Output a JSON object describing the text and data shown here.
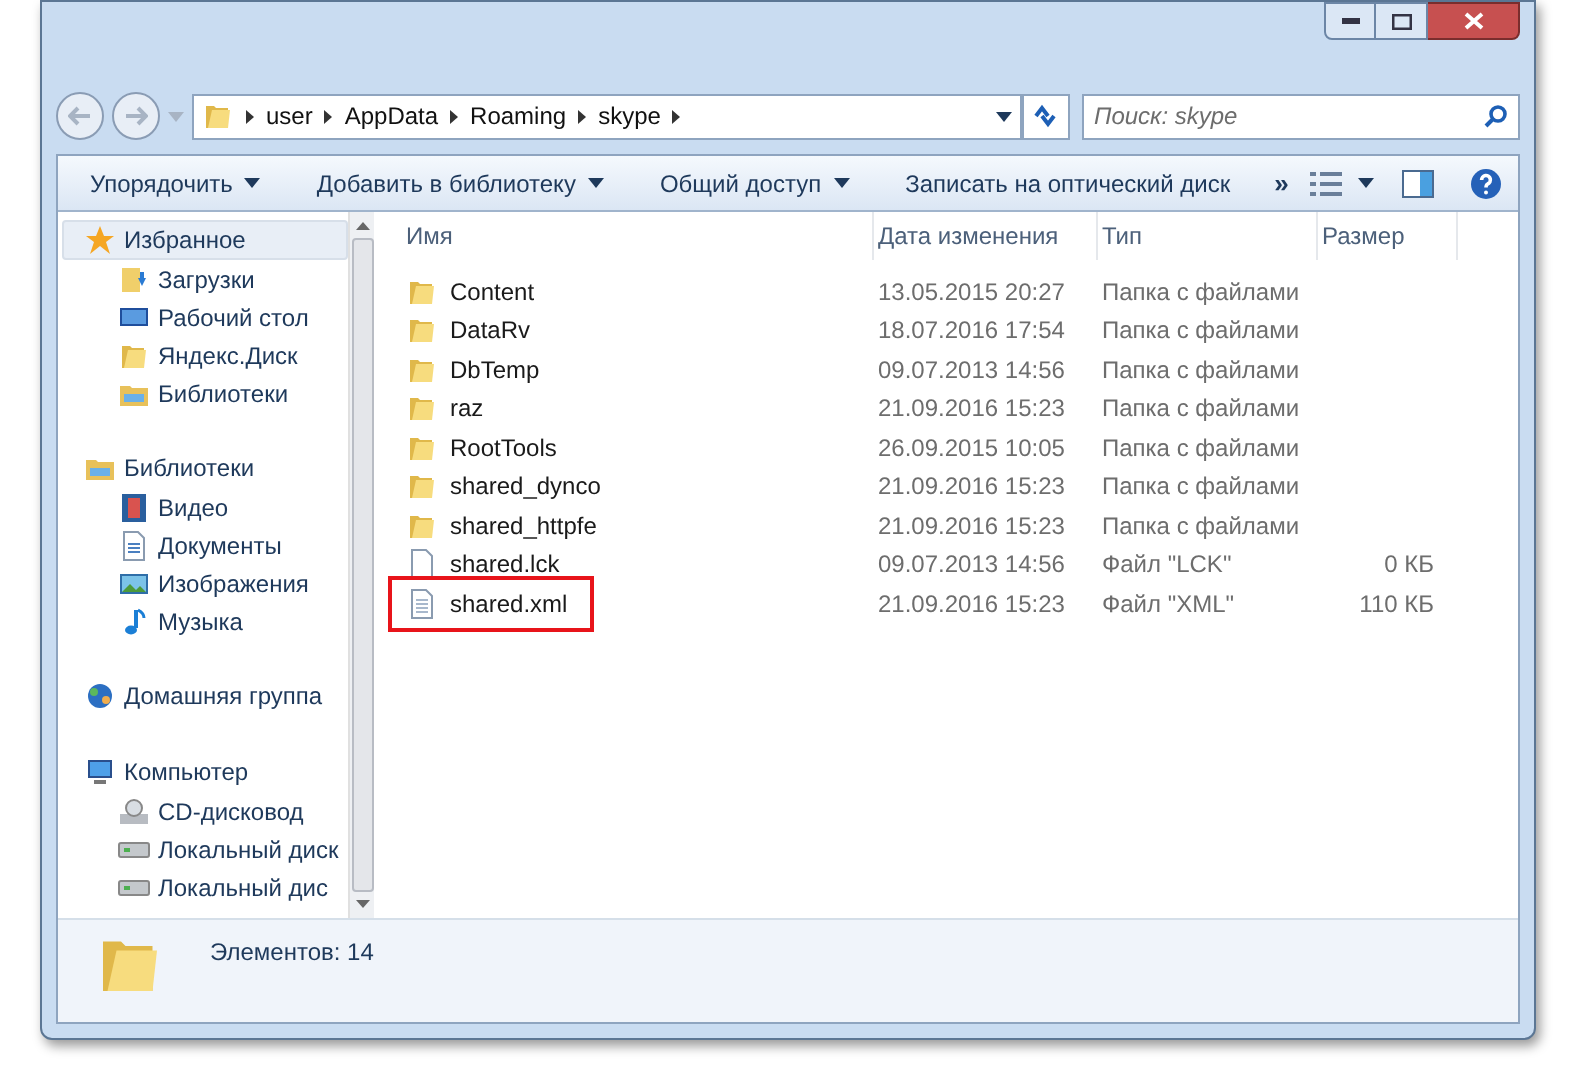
{
  "address": {
    "crumbs": [
      "user",
      "AppData",
      "Roaming",
      "skype"
    ]
  },
  "search": {
    "placeholder": "Поиск: skype"
  },
  "toolbar": {
    "items": [
      {
        "label": "Упорядочить",
        "dropdown": true
      },
      {
        "label": "Добавить в библиотеку",
        "dropdown": true
      },
      {
        "label": "Общий доступ",
        "dropdown": true
      },
      {
        "label": "Записать на оптический диск",
        "dropdown": false
      }
    ],
    "overflow": "»"
  },
  "sidebar": {
    "groups": [
      {
        "label": "Избранное",
        "kind": "star",
        "selected": true,
        "children": [
          {
            "label": "Загрузки",
            "kind": "downloads"
          },
          {
            "label": "Рабочий стол",
            "kind": "desktop"
          },
          {
            "label": "Яндекс.Диск",
            "kind": "folder"
          },
          {
            "label": "Библиотеки",
            "kind": "library"
          }
        ]
      },
      {
        "label": "Библиотеки",
        "kind": "library",
        "selected": false,
        "children": [
          {
            "label": "Видео",
            "kind": "video"
          },
          {
            "label": "Документы",
            "kind": "document"
          },
          {
            "label": "Изображения",
            "kind": "image"
          },
          {
            "label": "Музыка",
            "kind": "music"
          }
        ]
      },
      {
        "label": "Домашняя группа",
        "kind": "homegroup",
        "selected": false
      },
      {
        "label": "Компьютер",
        "kind": "computer",
        "selected": false,
        "children": [
          {
            "label": "CD-дисковод",
            "kind": "cd"
          },
          {
            "label": "Локальный диск",
            "kind": "disk"
          },
          {
            "label": "Локальный дис",
            "kind": "disk"
          }
        ]
      }
    ]
  },
  "table": {
    "columns": [
      "Имя",
      "Дата изменения",
      "Тип",
      "Размер"
    ],
    "rows": [
      {
        "kind": "folder",
        "name": "Content",
        "date": "13.05.2015 20:27",
        "type": "Папка с файлами",
        "marked": false
      },
      {
        "kind": "folder",
        "name": "DataRv",
        "date": "18.07.2016 17:54",
        "type": "Папка с файлами",
        "marked": false
      },
      {
        "kind": "folder",
        "name": "DbTemp",
        "date": "09.07.2013 14:56",
        "type": "Папка с файлами",
        "marked": false
      },
      {
        "kind": "folder",
        "name": "raz",
        "date": "21.09.2016 15:23",
        "type": "Папка с файлами",
        "marked": false
      },
      {
        "kind": "folder",
        "name": "RootTools",
        "date": "26.09.2015 10:05",
        "type": "Папка с файлами",
        "marked": false
      },
      {
        "kind": "folder",
        "name": "shared_dynco",
        "date": "21.09.2016 15:23",
        "type": "Папка с файлами",
        "marked": false
      },
      {
        "kind": "folder",
        "name": "shared_httpfe",
        "date": "21.09.2016 15:23",
        "type": "Папка с файлами",
        "marked": false
      },
      {
        "kind": "file",
        "name": "shared.lck",
        "date": "09.07.2013 14:56",
        "type": "Файл \"LCK\"",
        "size": "0 КБ",
        "marked": false
      },
      {
        "kind": "textfile",
        "name": "shared.xml",
        "date": "21.09.2016 15:23",
        "type": "Файл \"XML\"",
        "size": "110 КБ",
        "marked": true
      }
    ]
  },
  "status_bar": {
    "text": "Элементов: 14"
  }
}
